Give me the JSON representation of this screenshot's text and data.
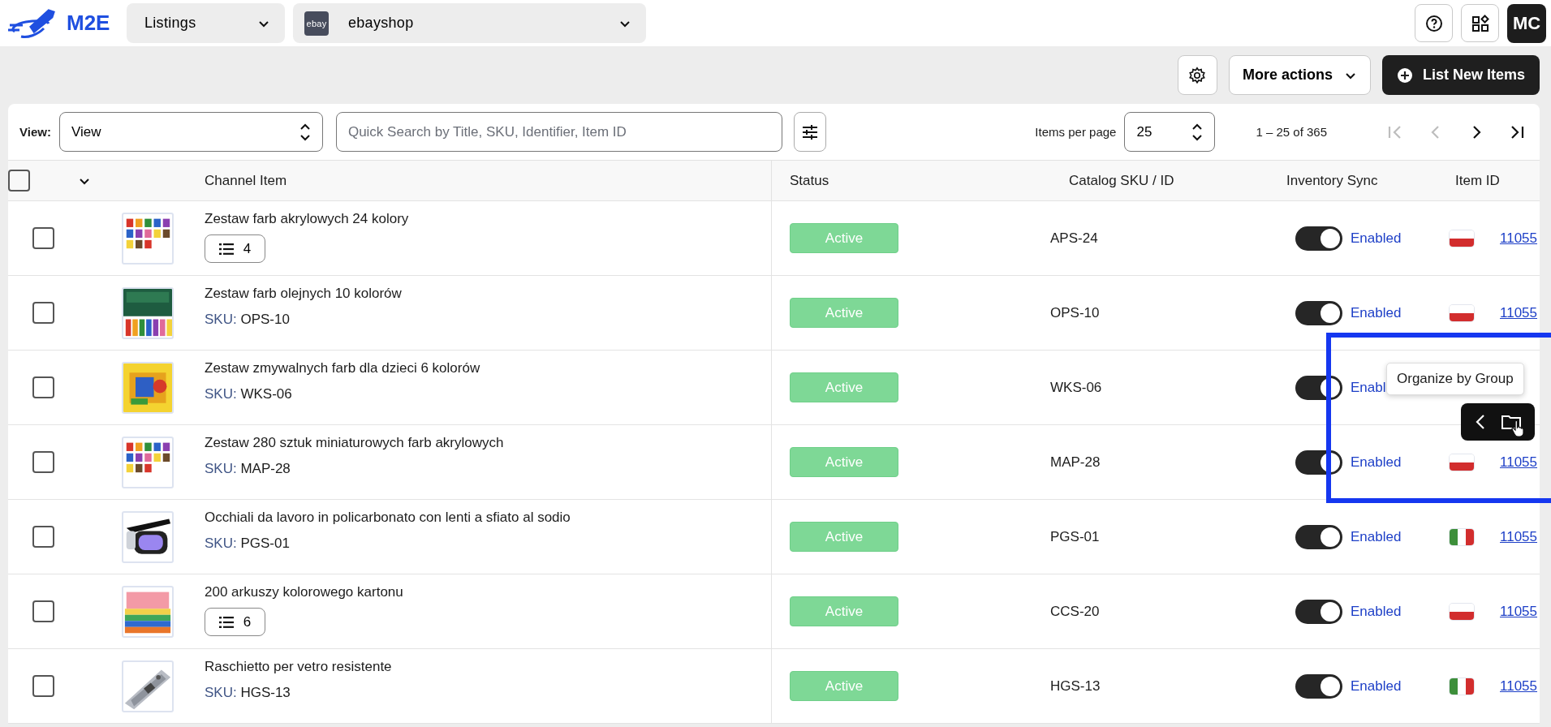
{
  "header": {
    "logo": "M2E",
    "section_select": {
      "value": "Listings"
    },
    "account_select": {
      "logo_text": "ebay",
      "value": "ebayshop"
    },
    "avatar": "MC"
  },
  "actions": {
    "more_actions": "More actions",
    "primary": "List New Items"
  },
  "toolbar": {
    "view_label": "View:",
    "view_select": "View",
    "search": {
      "placeholder": "Quick Search by Title, SKU, Identifier, Item ID"
    },
    "per_page_label": "Items per page",
    "per_page": "25",
    "range": "1 – 25 of 365",
    "pagination": [
      {
        "kind": "first",
        "disabled": true
      },
      {
        "kind": "prev",
        "disabled": true
      },
      {
        "kind": "next",
        "disabled": false
      },
      {
        "kind": "last",
        "disabled": false
      }
    ]
  },
  "table": {
    "select_all": {
      "checked": false
    },
    "columns": [
      "Channel Item",
      "Status",
      "Catalog SKU / ID",
      "Inventory Sync",
      "Item ID"
    ],
    "rows": [
      {
        "checked": false,
        "title": "Zestaw farb akrylowych 24 kolory",
        "variations": "4",
        "status": "Active",
        "catalog_sku": "APS-24",
        "sync": {
          "on": true,
          "label": "Enabled"
        },
        "flag": {
          "kind": "poland"
        },
        "item_id": "11055"
      },
      {
        "checked": false,
        "title": "Zestaw farb olejnych 10 kolorów",
        "sku_label": "SKU:",
        "sku": "OPS-10",
        "status": "Active",
        "catalog_sku": "OPS-10",
        "sync": {
          "on": true,
          "label": "Enabled"
        },
        "flag": {
          "kind": "poland"
        },
        "item_id": "11055"
      },
      {
        "checked": false,
        "title": "Zestaw zmywalnych farb dla dzieci 6 kolorów",
        "sku_label": "SKU:",
        "sku": "WKS-06",
        "status": "Active",
        "catalog_sku": "WKS-06",
        "sync": {
          "on": true,
          "label": "Enabl"
        }
      },
      {
        "checked": false,
        "title": "Zestaw 280 sztuk miniaturowych farb akrylowych",
        "sku_label": "SKU:",
        "sku": "MAP-28",
        "status": "Active",
        "catalog_sku": "MAP-28",
        "sync": {
          "on": true,
          "label": "Enabled"
        },
        "flag": {
          "kind": "poland"
        },
        "item_id": "11055"
      },
      {
        "checked": false,
        "title": "Occhiali da lavoro in policarbonato con lenti a sfiato al sodio",
        "sku_label": "SKU:",
        "sku": "PGS-01",
        "status": "Active",
        "catalog_sku": "PGS-01",
        "sync": {
          "on": true,
          "label": "Enabled"
        },
        "flag": {
          "kind": "italy"
        },
        "item_id": "11055"
      },
      {
        "checked": false,
        "title": "200 arkuszy kolorowego kartonu",
        "variations": "6",
        "status": "Active",
        "catalog_sku": "CCS-20",
        "sync": {
          "on": true,
          "label": "Enabled"
        },
        "flag": {
          "kind": "poland"
        },
        "item_id": "11055"
      },
      {
        "checked": false,
        "title": "Raschietto per vetro resistente",
        "sku_label": "SKU:",
        "sku": "HGS-13",
        "status": "Active",
        "catalog_sku": "HGS-13",
        "sync": {
          "on": true,
          "label": "Enabled"
        },
        "flag": {
          "kind": "italy"
        },
        "item_id": "11055"
      }
    ]
  },
  "tooltip": "Organize by Group"
}
